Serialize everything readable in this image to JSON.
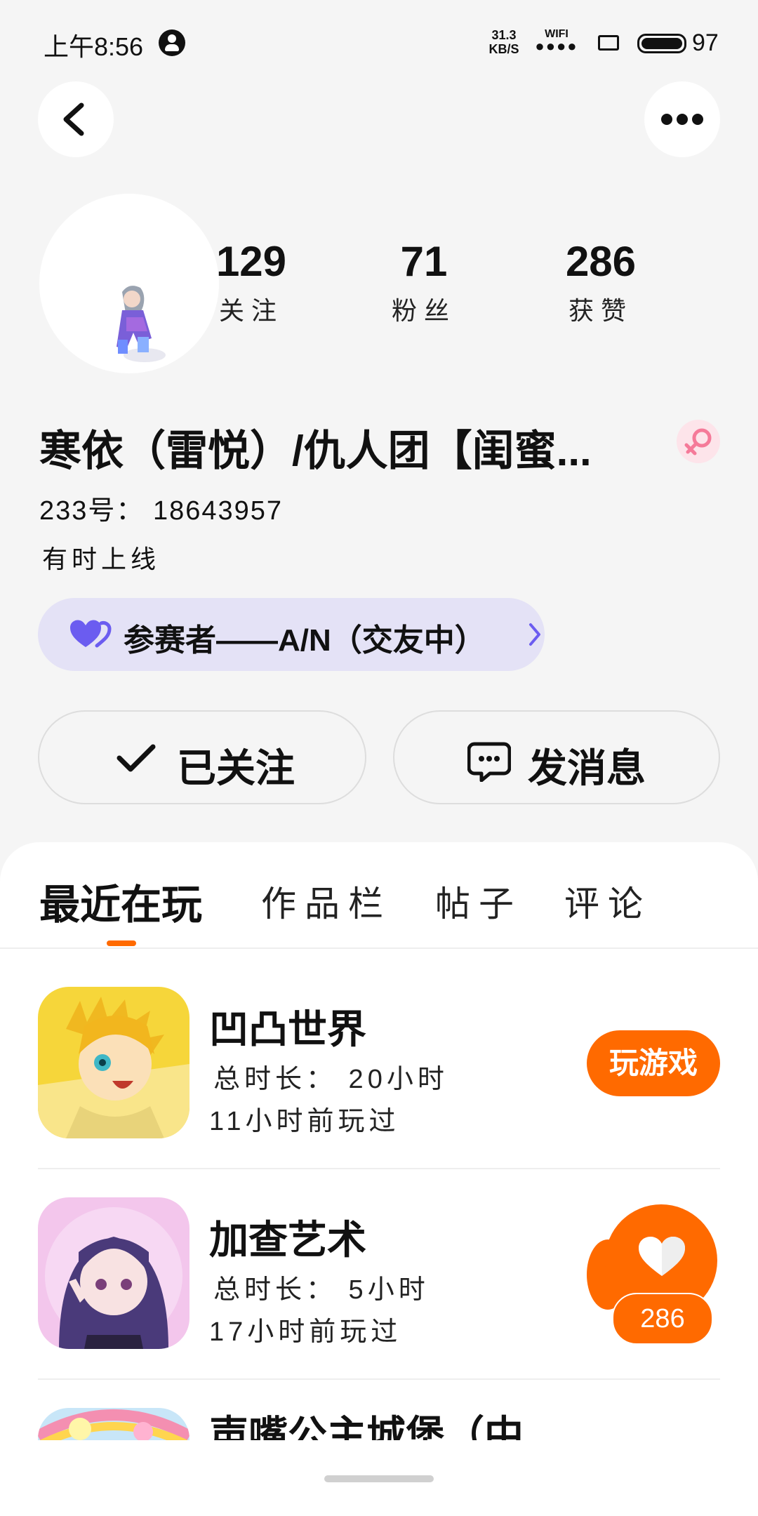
{
  "status_bar": {
    "time": "上午8:56",
    "speed_value": "31.3",
    "speed_unit": "KB/S",
    "wifi_label": "WIFI",
    "battery": "97"
  },
  "profile": {
    "stats": [
      {
        "value": "129",
        "label": "关注"
      },
      {
        "value": "71",
        "label": "粉丝"
      },
      {
        "value": "286",
        "label": "获赞"
      }
    ],
    "name": "寒依（雷悦）/仇人团【闺蜜...",
    "uid": "233号： 18643957",
    "status": "有时上线",
    "tag": "参赛者——A/N（交友中）",
    "follow_label": "已关注",
    "message_label": "发消息"
  },
  "tabs": [
    "最近在玩",
    "作品栏",
    "帖子",
    "评论"
  ],
  "games": [
    {
      "name": "凹凸世界",
      "total": "总时长： 20小时",
      "last": "11小时前玩过",
      "button": "玩游戏"
    },
    {
      "name": "加查艺术",
      "total": "总时长： 5小时",
      "last": "17小时前玩过"
    },
    {
      "name": "声嘴公主城堡（中"
    }
  ],
  "like_count": "286",
  "colors": {
    "accent": "#ff6a00",
    "tag_bg": "#e4e2f6",
    "tag_heart": "#6b5cf0",
    "gender_icon": "#f57a99"
  }
}
